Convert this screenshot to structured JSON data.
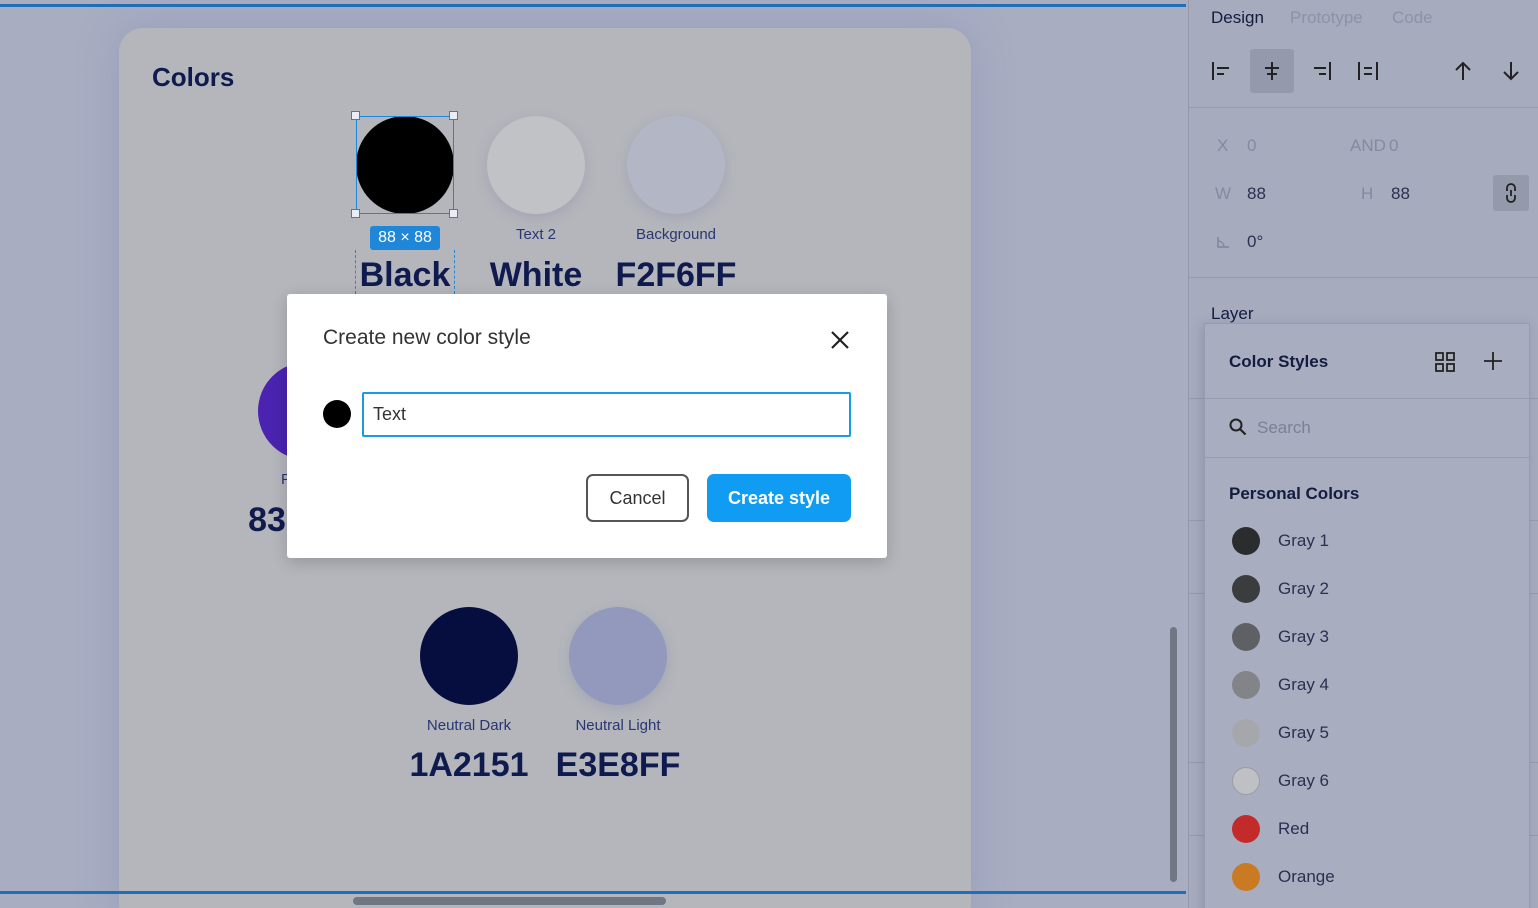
{
  "canvas": {
    "frame_title": "Colors",
    "selection_size": "88 × 88",
    "swatches": [
      {
        "label": "",
        "value": "Black",
        "color": "#000000"
      },
      {
        "label": "Text 2",
        "value": "White",
        "color": "#c0c2c6"
      },
      {
        "label": "Background",
        "value": "F2F6FF",
        "color": "#b3b6c4"
      },
      {
        "label": "P",
        "value": "83",
        "color": "#4a23b0"
      },
      {
        "label": "Neutral Dark",
        "value": "1A2151",
        "color": "#060e3f"
      },
      {
        "label": "Neutral Light",
        "value": "E3E8FF",
        "color": "#9299bd"
      }
    ]
  },
  "dialog": {
    "title": "Create new color style",
    "input_value": "Text",
    "cancel_label": "Cancel",
    "create_label": "Create style"
  },
  "panel": {
    "tabs": [
      "Design",
      "Prototype",
      "Code"
    ],
    "props": {
      "x_label": "X",
      "x_value": "0",
      "y_label": "AND",
      "y_value": "0",
      "w_label": "W",
      "w_value": "88",
      "h_label": "H",
      "h_value": "88",
      "rotation_value": "0°"
    },
    "layer_title": "Layer"
  },
  "color_styles": {
    "title": "Color Styles",
    "search_placeholder": "Search",
    "group": "Personal Colors",
    "items": [
      {
        "name": "Gray 1",
        "color": "#2b2c2e"
      },
      {
        "name": "Gray 2",
        "color": "#3b3c3e"
      },
      {
        "name": "Gray 3",
        "color": "#5f6063"
      },
      {
        "name": "Gray 4",
        "color": "#838487"
      },
      {
        "name": "Gray 5",
        "color": "#a6a7aa"
      },
      {
        "name": "Gray 6",
        "color": "#bfc0c3"
      },
      {
        "name": "Red",
        "color": "#c32a2a"
      },
      {
        "name": "Orange",
        "color": "#c97a22"
      }
    ]
  }
}
